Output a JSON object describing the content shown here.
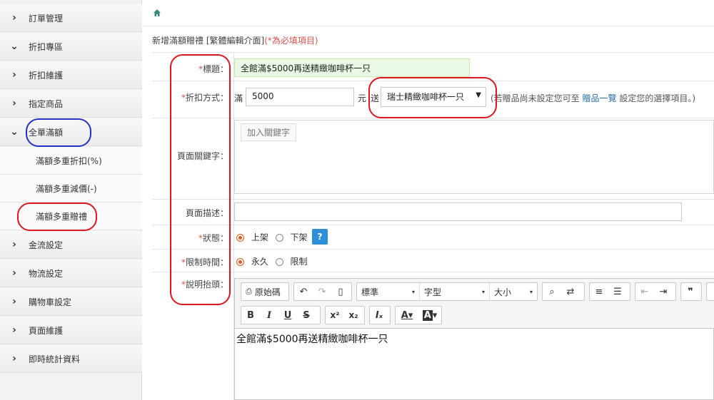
{
  "sidebar": {
    "items": [
      {
        "arrow": "❯",
        "label": "訂單管理"
      },
      {
        "arrow": "❮",
        "label": "折扣專區"
      },
      {
        "arrow": "❯",
        "label": "折扣維護"
      },
      {
        "arrow": "❯",
        "label": "指定商品"
      },
      {
        "arrow": "❮",
        "label": "全單滿額"
      },
      {
        "arrow": "❯",
        "label": "金流設定"
      },
      {
        "arrow": "❯",
        "label": "物流設定"
      },
      {
        "arrow": "❯",
        "label": "購物車設定"
      },
      {
        "arrow": "❯",
        "label": "頁面維護"
      },
      {
        "arrow": "❯",
        "label": "即時統計資料"
      }
    ],
    "subitems": [
      {
        "label": "滿額多重折扣(%)"
      },
      {
        "label": "滿額多重減價(-)"
      },
      {
        "label": "滿額多重贈禮"
      }
    ]
  },
  "main": {
    "page_title": "新增滿額贈禮 [繁體編輯介面]",
    "required_note": "(*為必填項目)",
    "form": {
      "title_label": "標題：",
      "title_value": "全館滿$5000再送精緻咖啡杯一只",
      "discount_label": "折扣方式：",
      "full_prefix": "滿",
      "amount_value": "5000",
      "unit_label": "元",
      "gift_prefix": "送",
      "gift_selected": "瑞士精緻咖啡杯一只",
      "gift_hint_1": "(若贈品尚未設定您可至",
      "gift_hint_link": "贈品一覽",
      "gift_hint_2": "設定您的選擇項目。)",
      "keyword_label": "頁面關鍵字：",
      "keyword_placeholder": "加入關鍵字",
      "desc_label": "頁面描述：",
      "desc_value": "",
      "status_label": "狀態：",
      "status_on": "上架",
      "status_off": "下架",
      "help_text": "?",
      "time_label": "限制時間：",
      "time_forever": "永久",
      "time_limited": "限制",
      "content_label": "說明抬頭："
    },
    "editor": {
      "source_label": "原始碼",
      "format_label": "標準",
      "font_label": "字型",
      "size_label": "大小",
      "body_text": "全館滿$5000再送精緻咖啡杯一只"
    }
  }
}
